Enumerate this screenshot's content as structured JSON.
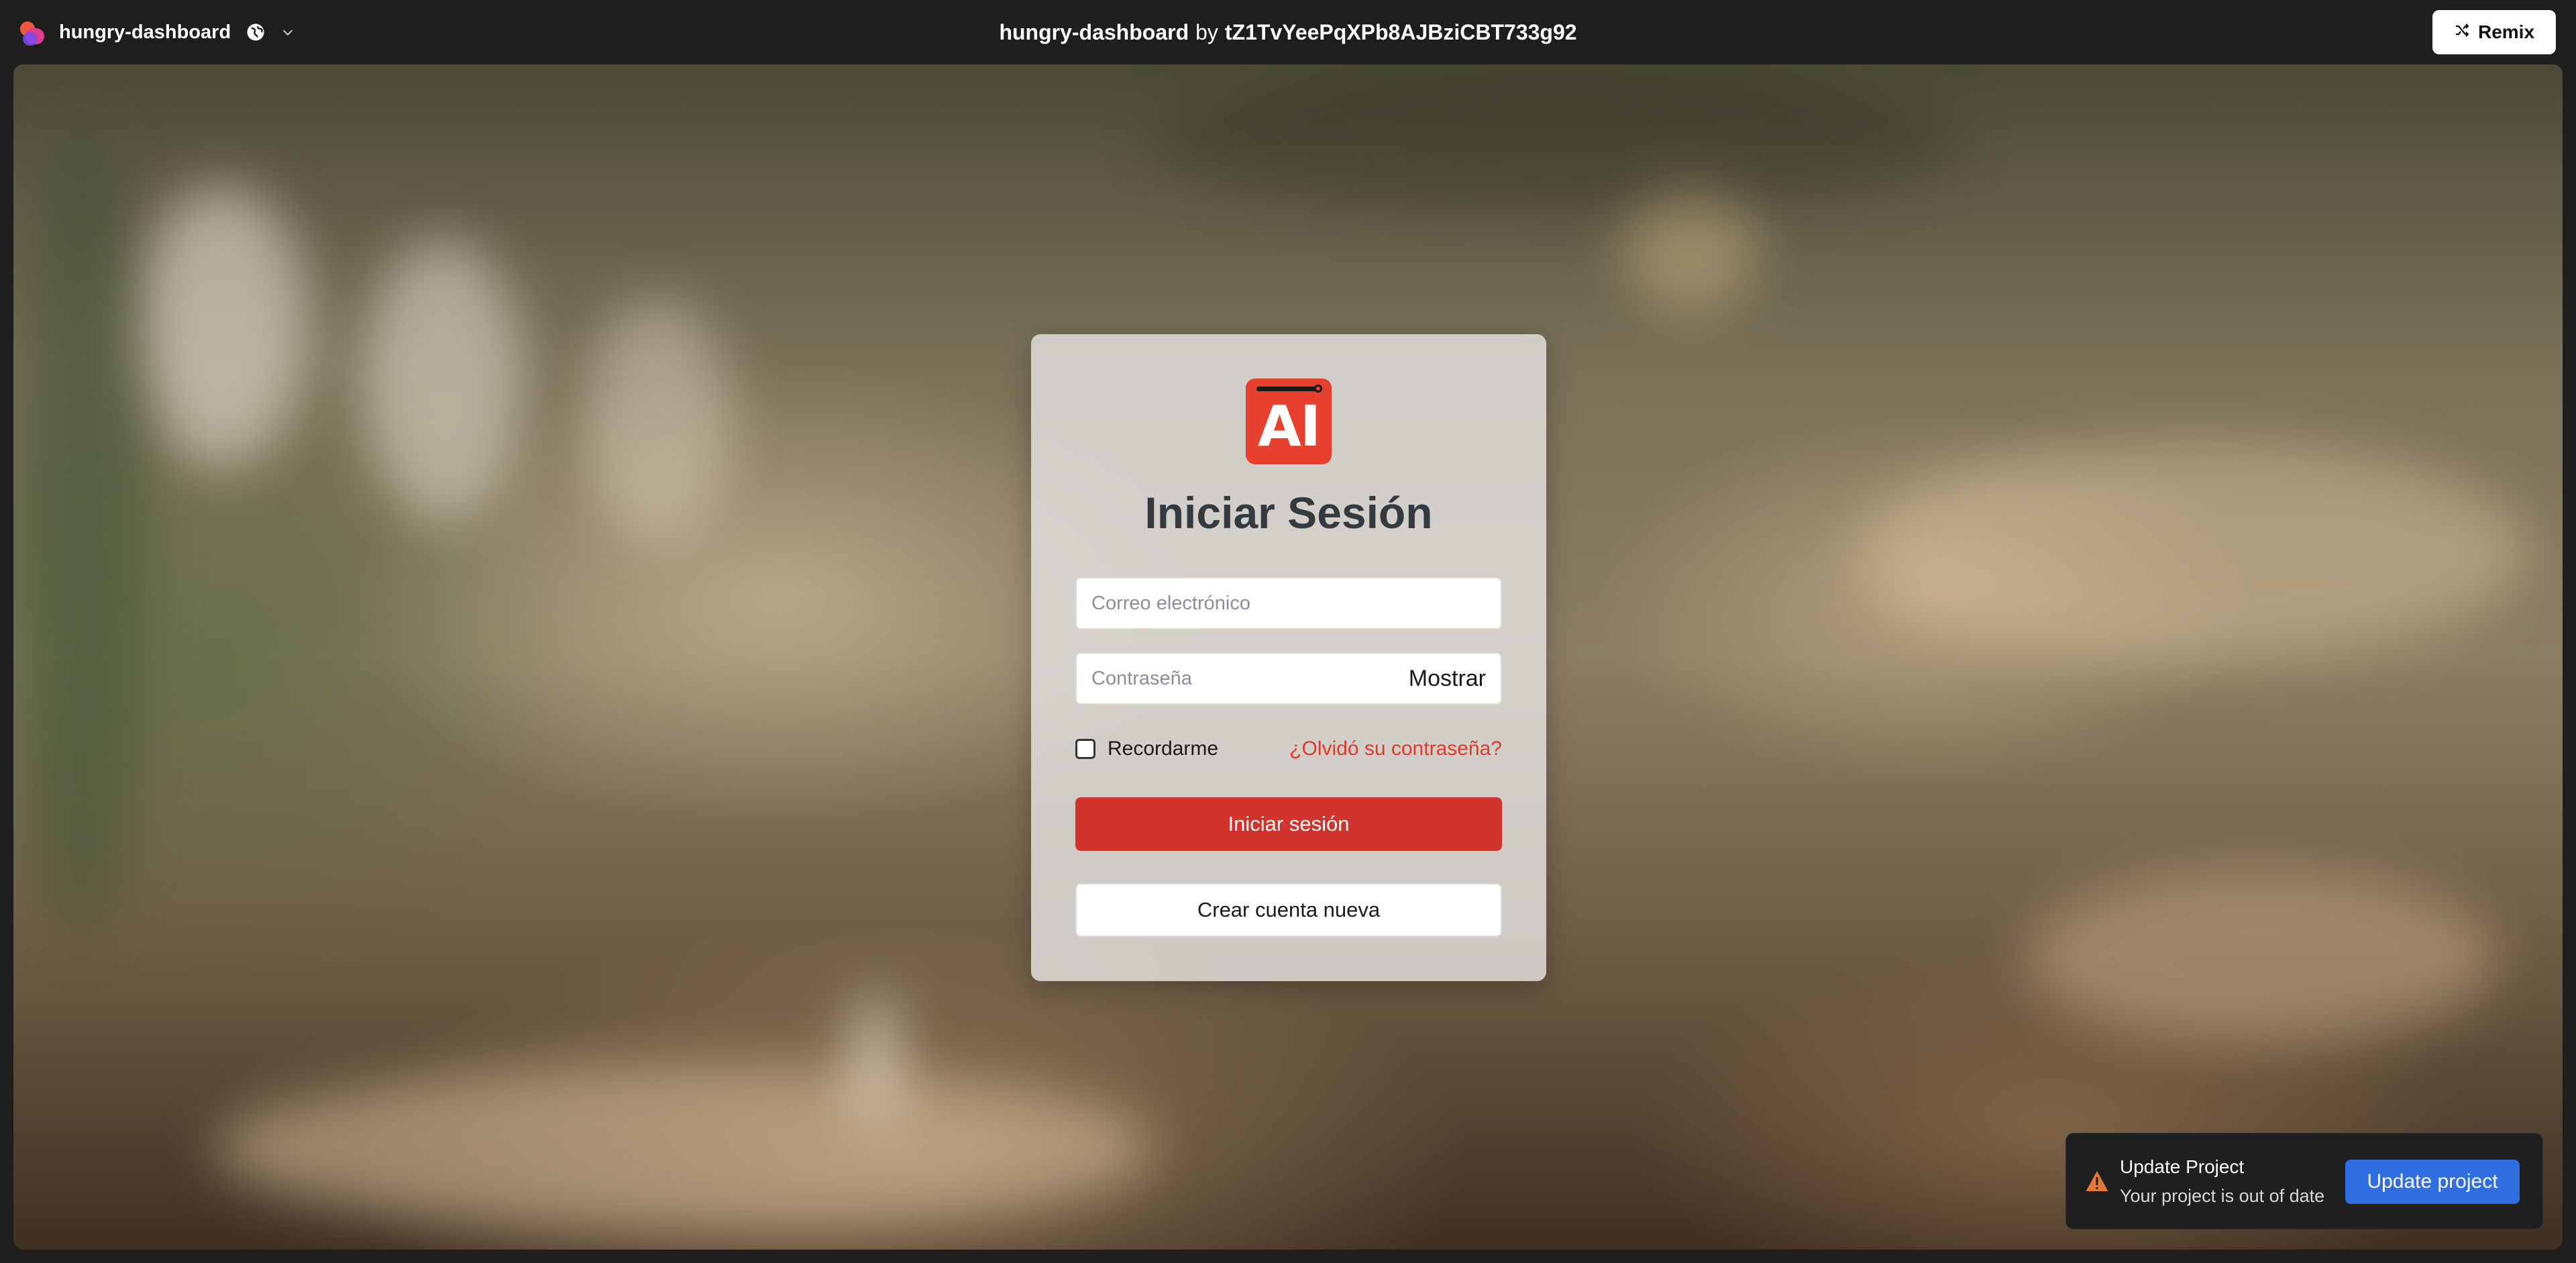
{
  "topbar": {
    "project_name": "hungry-dashboard",
    "title_project": "hungry-dashboard",
    "title_by": "by",
    "title_owner": "tZ1TvYeePqXPb8AJBziCBT733g92",
    "remix_label": "Remix",
    "icons": [
      "app-logo-icon",
      "globe-icon",
      "chevron-down-icon",
      "shuffle-icon"
    ]
  },
  "login": {
    "logo_text": "AI",
    "title": "Iniciar Sesión",
    "email_placeholder": "Correo electrónico",
    "email_value": "",
    "password_placeholder": "Contraseña",
    "password_value": "",
    "show_label": "Mostrar",
    "remember_label": "Recordarme",
    "remember_checked": false,
    "forgot_label": "¿Olvidó su contraseña?",
    "submit_label": "Iniciar sesión",
    "create_account_label": "Crear cuenta nueva"
  },
  "toast": {
    "title": "Update Project",
    "message": "Your project is out of date",
    "button_label": "Update project",
    "icon": "warning-icon"
  },
  "colors": {
    "brand_red": "#d1342c",
    "logo_red": "#e8402f",
    "link_red": "#e0392c",
    "update_blue": "#2f6ee0",
    "topbar_bg": "#1e1e1e"
  }
}
